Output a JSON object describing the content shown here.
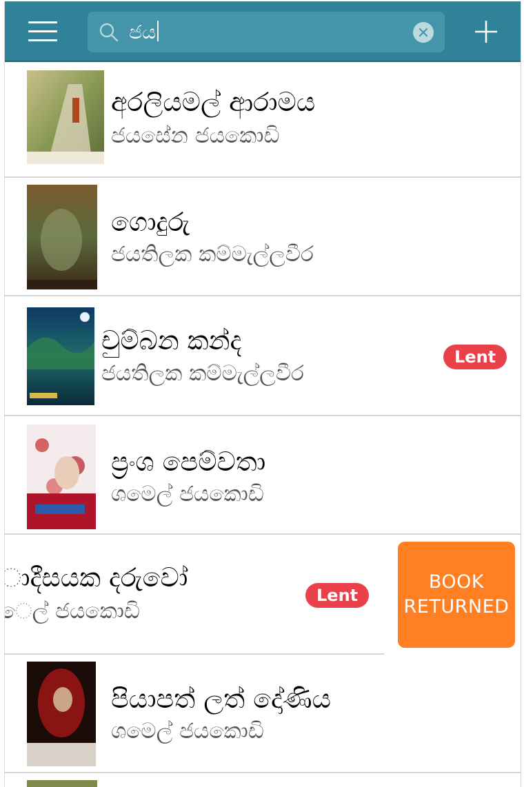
{
  "search": {
    "query": "ජය"
  },
  "books": [
    {
      "title": "අරලියමල් ආරාමය",
      "author": "ජයසේන ජයකොඩි",
      "lent": false
    },
    {
      "title": "ගොදුරු",
      "author": "ජයතිලක කම්මැල්ලවීර",
      "lent": false
    },
    {
      "title": "චුම්බන කන්ද",
      "author": "ජයතිලක කම්මැල්ලවීර",
      "lent": true
    },
    {
      "title": "ප්‍රංශ පෙම්වතා",
      "author": "ශමෙල් ජයකොඩි",
      "lent": false
    },
    {
      "title": "ාදීසයක දරුවෝ",
      "author": "ෙල් ජයකොඩි",
      "lent": true
    },
    {
      "title": "පියාපත් ලත් දෝණිය",
      "author": "ශමෙල් ජයකොඩි",
      "lent": false
    }
  ],
  "badge_label": "Lent",
  "swipe_action": {
    "line1": "BOOK",
    "line2": "RETURNED"
  },
  "colors": {
    "topbar": "#2f8297",
    "lent_badge": "#e9414a",
    "swipe_action": "#ff7f22"
  },
  "icons": {
    "menu": "hamburger-icon",
    "search": "search-icon",
    "clear": "clear-icon",
    "add": "plus-icon"
  }
}
